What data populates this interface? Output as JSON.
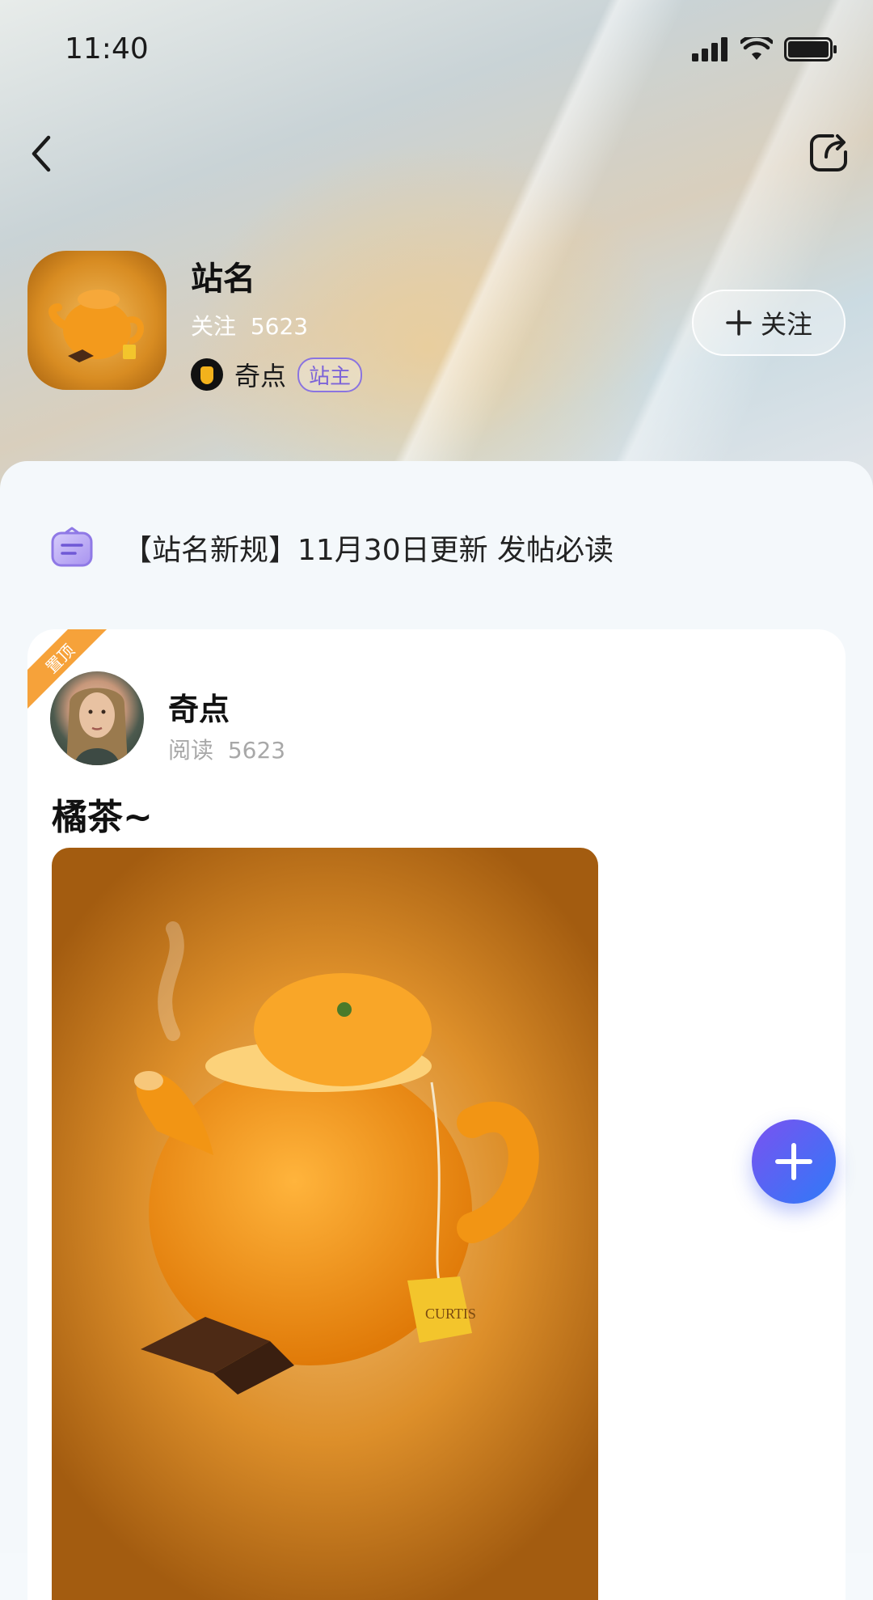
{
  "status_bar": {
    "time": "11:40"
  },
  "site": {
    "name": "站名",
    "follow_label": "关注",
    "follow_count": "5623",
    "owner_name": "奇点",
    "owner_badge": "站主",
    "follow_button_label": "关注"
  },
  "notice": {
    "text": "【站名新规】11月30日更新 发帖必读"
  },
  "post": {
    "pin_label": "置顶",
    "author_name": "奇点",
    "read_label": "阅读",
    "read_count": "5623",
    "title": "橘茶~"
  },
  "colors": {
    "accent_purple": "#8a74e0",
    "pin_orange": "#f6a23a",
    "fab_gradient_start": "#7a52f0",
    "fab_gradient_end": "#2f7af8"
  },
  "icons": [
    "back-icon",
    "share-icon",
    "signal-icon",
    "wifi-icon",
    "battery-icon",
    "plus-icon",
    "notice-icon"
  ]
}
